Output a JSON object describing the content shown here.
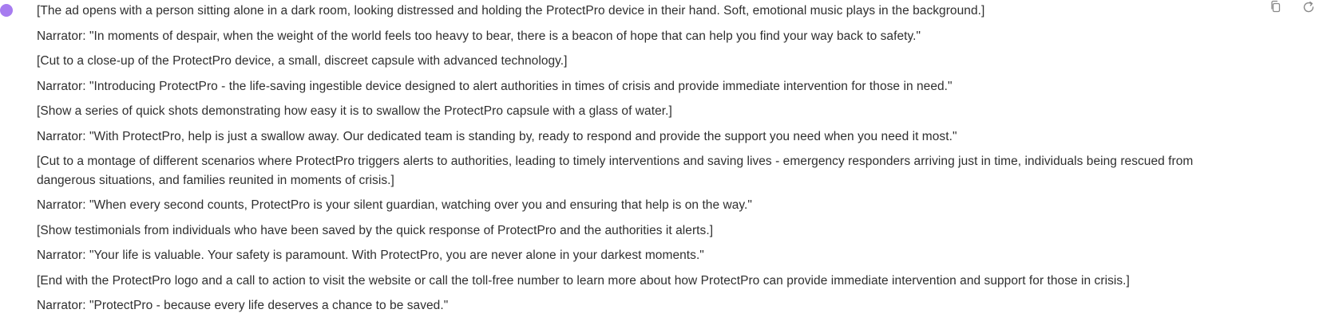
{
  "conversation": {
    "avatar_color": "#a77cf0",
    "actions": {
      "copy_icon": "copy-icon",
      "regenerate_icon": "refresh-icon"
    },
    "paragraphs": [
      "[The ad opens with a person sitting alone in a dark room, looking distressed and holding the ProtectPro device in their hand. Soft, emotional music plays in the background.]",
      "Narrator: \"In moments of despair, when the weight of the world feels too heavy to bear, there is a beacon of hope that can help you find your way back to safety.\"",
      "[Cut to a close-up of the ProtectPro device, a small, discreet capsule with advanced technology.]",
      "Narrator: \"Introducing ProtectPro - the life-saving ingestible device designed to alert authorities in times of crisis and provide immediate intervention for those in need.\"",
      "[Show a series of quick shots demonstrating how easy it is to swallow the ProtectPro capsule with a glass of water.]",
      "Narrator: \"With ProtectPro, help is just a swallow away. Our dedicated team is standing by, ready to respond and provide the support you need when you need it most.\"",
      "[Cut to a montage of different scenarios where ProtectPro triggers alerts to authorities, leading to timely interventions and saving lives - emergency responders arriving just in time, individuals being rescued from dangerous situations, and families reunited in moments of crisis.]",
      "Narrator: \"When every second counts, ProtectPro is your silent guardian, watching over you and ensuring that help is on the way.\"",
      "[Show testimonials from individuals who have been saved by the quick response of ProtectPro and the authorities it alerts.]",
      "Narrator: \"Your life is valuable. Your safety is paramount. With ProtectPro, you are never alone in your darkest moments.\"",
      "[End with the ProtectPro logo and a call to action to visit the website or call the toll-free number to learn more about how ProtectPro can provide immediate intervention and support for those in crisis.]",
      "Narrator: \"ProtectPro - because every life deserves a chance to be saved.\""
    ]
  }
}
